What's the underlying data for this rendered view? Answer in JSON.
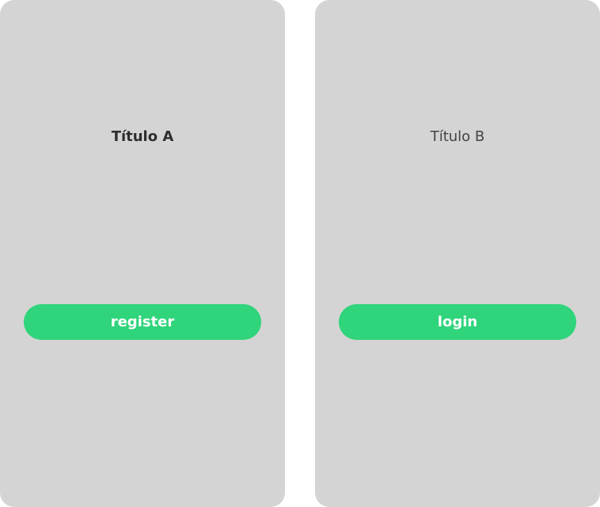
{
  "screens": [
    {
      "title": "Título A",
      "button_label": "register"
    },
    {
      "title": "Título B",
      "button_label": "login"
    }
  ],
  "colors": {
    "card_background": "#d4d4d4",
    "button_background": "#2fd47b",
    "button_text": "#ffffff",
    "title_text": "#333333"
  }
}
